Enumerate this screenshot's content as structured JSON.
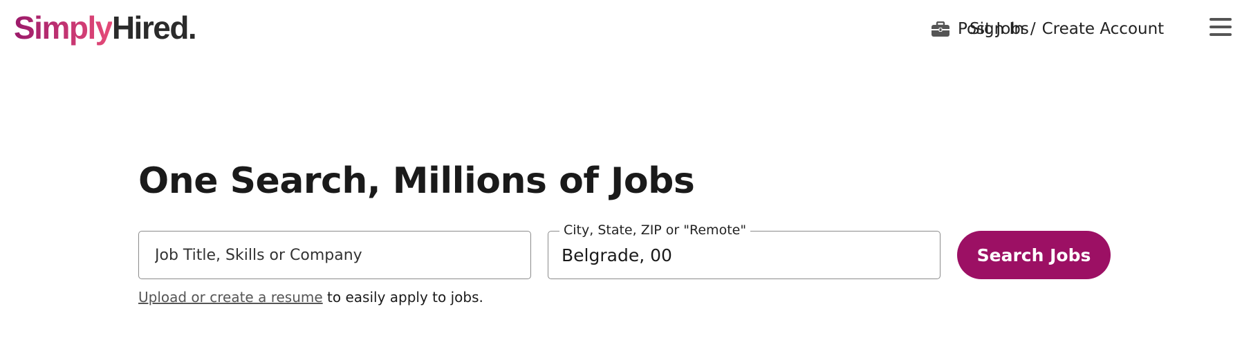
{
  "header": {
    "logo": {
      "part1": "Simply",
      "part2": "Hired",
      "dot": "."
    },
    "nav": {
      "post_jobs": "Post Jobs",
      "sign_in": "Sign In",
      "separator": "/",
      "create_account": "Create Account"
    },
    "icons": {
      "post_jobs": "briefcase-icon",
      "menu": "hamburger-menu-icon"
    }
  },
  "hero": {
    "title": "One Search, Millions of Jobs"
  },
  "search": {
    "what_placeholder": "Job Title, Skills or Company",
    "where_label": "City, State, ZIP or \"Remote\"",
    "where_value": "Belgrade, 00",
    "button_label": "Search Jobs"
  },
  "resume": {
    "link_text": "Upload or create a resume",
    "suffix": " to easily apply to jobs."
  },
  "colors": {
    "brand_primary": "#9c1064",
    "logo_gradient_start": "#9b1a6a",
    "logo_gradient_end": "#e64b78",
    "text_dark": "#1a1a1a",
    "border": "#8a8a8a"
  }
}
